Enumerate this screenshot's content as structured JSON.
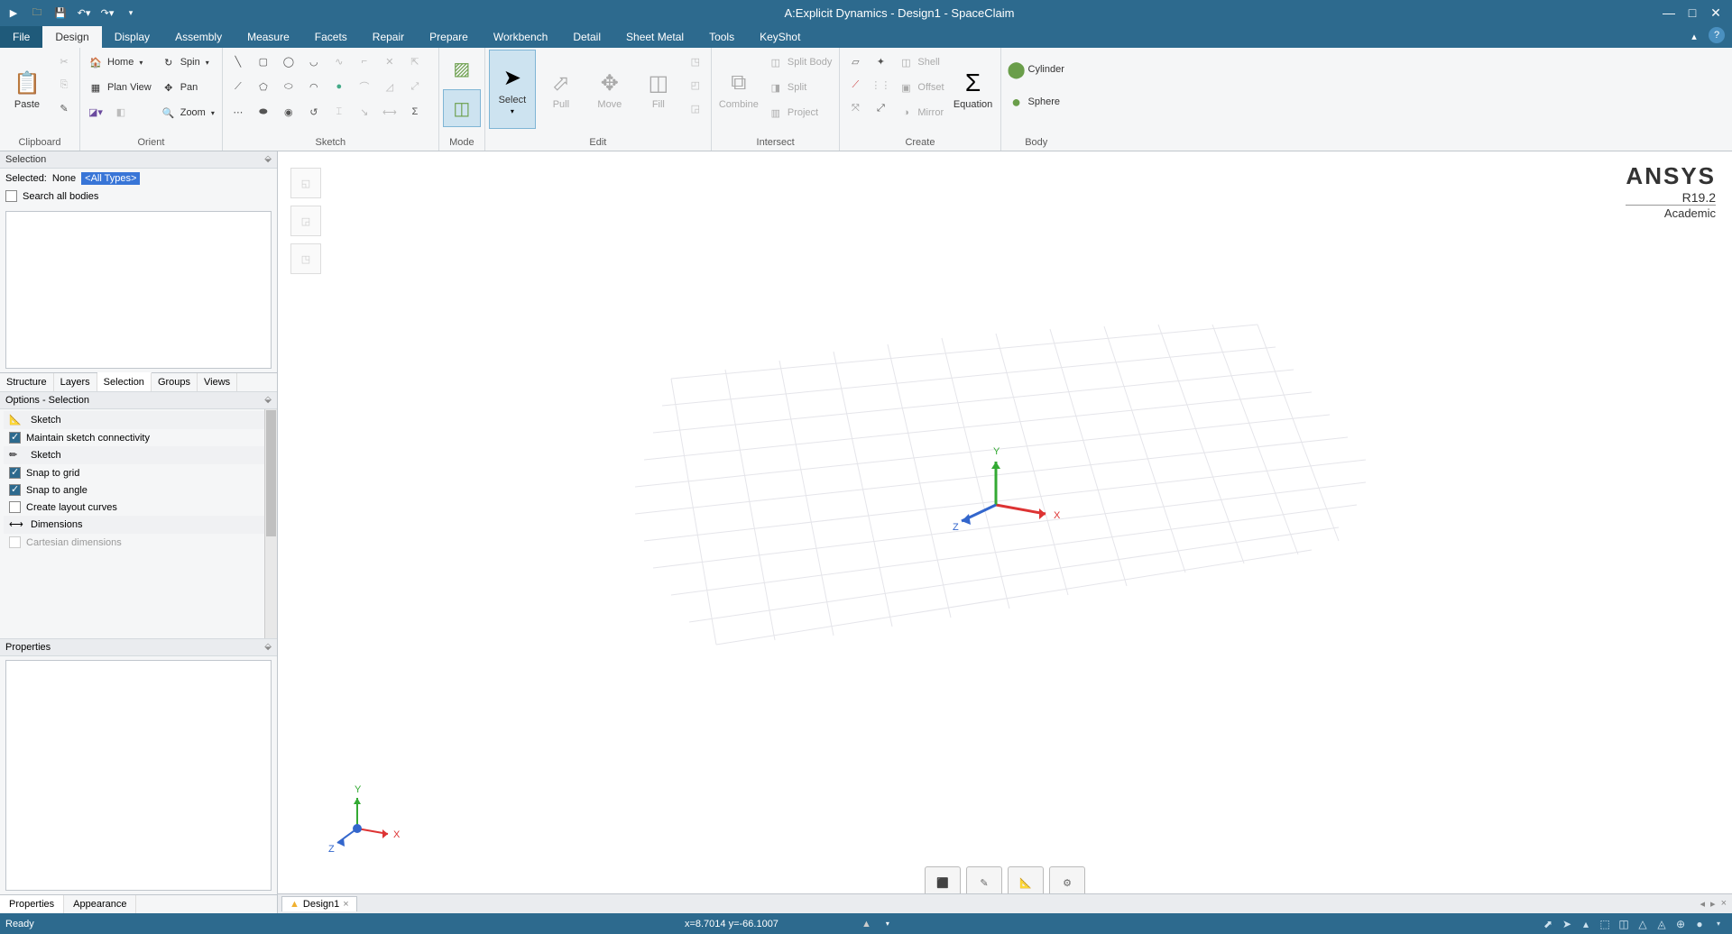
{
  "title": "A:Explicit Dynamics - Design1 - SpaceClaim",
  "menu": {
    "file": "File",
    "tabs": [
      "Design",
      "Display",
      "Assembly",
      "Measure",
      "Facets",
      "Repair",
      "Prepare",
      "Workbench",
      "Detail",
      "Sheet Metal",
      "Tools",
      "KeyShot"
    ]
  },
  "ribbon": {
    "clipboard": {
      "paste": "Paste",
      "label": "Clipboard"
    },
    "orient": {
      "home": "Home",
      "spin": "Spin",
      "plan": "Plan View",
      "pan": "Pan",
      "zoom": "Zoom",
      "label": "Orient"
    },
    "sketch": {
      "label": "Sketch"
    },
    "mode": {
      "label": "Mode"
    },
    "edit": {
      "select": "Select",
      "pull": "Pull",
      "move": "Move",
      "fill": "Fill",
      "label": "Edit"
    },
    "intersect": {
      "combine": "Combine",
      "split": "Split Body",
      "splitface": "Split",
      "project": "Project",
      "label": "Intersect"
    },
    "create": {
      "shell": "Shell",
      "offset": "Offset",
      "mirror": "Mirror",
      "equation": "Equation",
      "label": "Create"
    },
    "body": {
      "cylinder": "Cylinder",
      "sphere": "Sphere",
      "label": "Body"
    }
  },
  "selection": {
    "header": "Selection",
    "selected_lbl": "Selected:",
    "selected_val": "None",
    "alltypes": "<All Types>",
    "search": "Search all bodies",
    "tabs": [
      "Structure",
      "Layers",
      "Selection",
      "Groups",
      "Views"
    ]
  },
  "options": {
    "header": "Options - Selection",
    "sketch": "Sketch",
    "maintain": "Maintain sketch connectivity",
    "sketch2": "Sketch",
    "snapgrid": "Snap to grid",
    "snapangle": "Snap to angle",
    "layout": "Create layout curves",
    "dimensions": "Dimensions",
    "cartesian": "Cartesian dimensions"
  },
  "properties": {
    "header": "Properties",
    "tabs": [
      "Properties",
      "Appearance"
    ]
  },
  "brand": {
    "l1": "ANSYS",
    "l2": "R19.2",
    "l3": "Academic"
  },
  "doctab": "Design1",
  "status": {
    "ready": "Ready",
    "coords": "x=8.7014 y=-66.1007"
  }
}
